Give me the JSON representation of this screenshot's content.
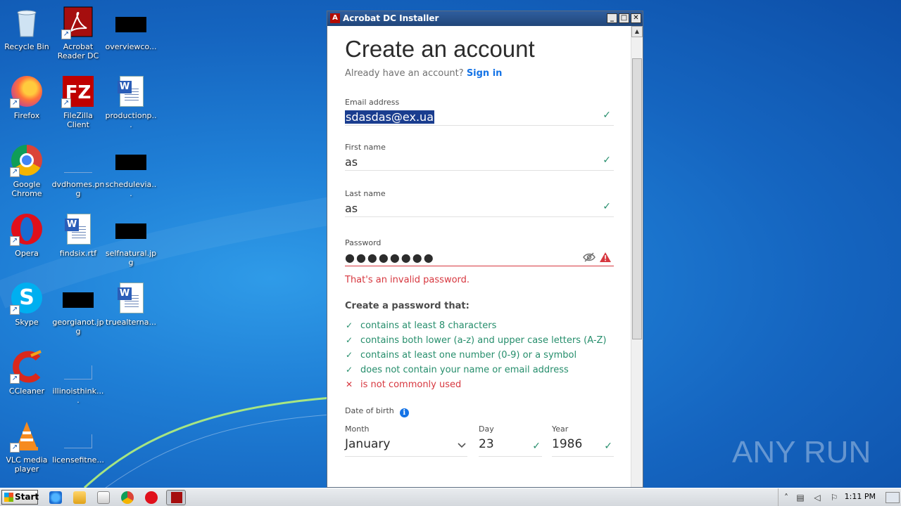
{
  "desktop": {
    "icons": [
      {
        "label": "Recycle Bin"
      },
      {
        "label": "Acrobat Reader DC"
      },
      {
        "label": "overviewco..."
      },
      {
        "label": "Firefox"
      },
      {
        "label": "FileZilla Client"
      },
      {
        "label": "productionp..."
      },
      {
        "label": "Google Chrome"
      },
      {
        "label": "dvdhomes.png"
      },
      {
        "label": "schedulevia..."
      },
      {
        "label": "Opera"
      },
      {
        "label": "findsix.rtf"
      },
      {
        "label": "selfnatural.jpg"
      },
      {
        "label": "Skype"
      },
      {
        "label": "georgianot.jpg"
      },
      {
        "label": "truealterna..."
      },
      {
        "label": "CCleaner"
      },
      {
        "label": "illinoisthink...."
      },
      {
        "label": "VLC media player"
      },
      {
        "label": "licensefitne..."
      }
    ]
  },
  "window": {
    "title": "Acrobat DC Installer",
    "min_glyph": "_",
    "max_glyph": "□",
    "close_glyph": "✕",
    "app_glyph": "A"
  },
  "form": {
    "heading": "Create an account",
    "signin_prompt": "Already have an account?",
    "signin_link": "Sign in",
    "email": {
      "label": "Email address",
      "value": "sdasdas@ex.ua"
    },
    "first_name": {
      "label": "First name",
      "value": "as"
    },
    "last_name": {
      "label": "Last name",
      "value": "as"
    },
    "password": {
      "label": "Password",
      "value": "●●●●●●●●"
    },
    "error": "That's an invalid password.",
    "rules_title": "Create a password that:",
    "rules": [
      {
        "text": "contains at least 8 characters",
        "mark": "✓"
      },
      {
        "text": "contains both lower (a-z) and upper case letters (A-Z)",
        "mark": "✓"
      },
      {
        "text": "contains at least one number (0-9) or a symbol",
        "mark": "✓"
      },
      {
        "text": "does not contain your name or email address",
        "mark": "✓"
      },
      {
        "text": "is not commonly used",
        "mark": "✕"
      }
    ],
    "dob_label": "Date of birth",
    "info_glyph": "i",
    "month": {
      "label": "Month",
      "value": "January"
    },
    "day": {
      "label": "Day",
      "value": "23"
    },
    "year": {
      "label": "Year",
      "value": "1986"
    },
    "check_glyph": "✓",
    "chevron_glyph": "⌄"
  },
  "taskbar": {
    "start_label": "Start",
    "clock": "1:11 PM"
  },
  "watermark": "ANY RUN",
  "colors": {
    "accent_blue": "#1473e6",
    "valid_green": "#268e6c",
    "error_red": "#d7373f"
  }
}
